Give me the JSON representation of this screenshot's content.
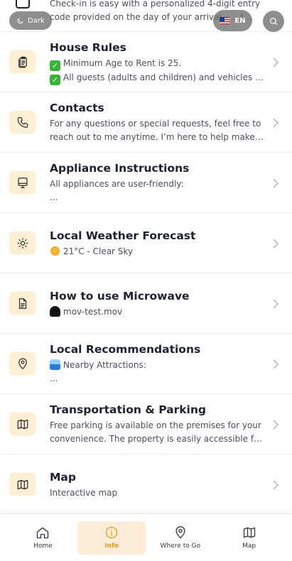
{
  "overlay": {
    "dark_label": "Dark",
    "lang_label": "EN"
  },
  "items": [
    {
      "title": "",
      "lines": [
        "Check-in is easy with a personalized 4-digit entry",
        "code provided on the day of your arrival... ...t..."
      ]
    },
    {
      "title": "House Rules",
      "lines": [
        "Minimum Age to Rent is 25.",
        "All guests (adults and children) and vehicles mu..."
      ]
    },
    {
      "title": "Contacts",
      "lines": [
        "For any questions or special requests, feel free to",
        "reach out to me anytime. I’m here to help make you..."
      ]
    },
    {
      "title": "Appliance Instructions",
      "lines": [
        "All appliances are user-friendly:",
        "..."
      ]
    },
    {
      "title": "Local Weather Forecast",
      "lines": [
        "21°C - Clear Sky"
      ]
    },
    {
      "title": "How to use Microwave",
      "lines": [
        "mov-test.mov"
      ]
    },
    {
      "title": "Local Recommendations",
      "lines": [
        "Nearby Attractions:",
        "..."
      ]
    },
    {
      "title": "Transportation & Parking",
      "lines": [
        "Free parking is available on the premises for your",
        "convenience. The property is easily accessible for..."
      ]
    },
    {
      "title": "Map",
      "lines": [
        "Interactive map"
      ]
    }
  ],
  "icons": {
    "house_rules": "clipboard-icon",
    "contacts": "phone-icon",
    "appliance": "monitor-icon",
    "weather": "sun-icon",
    "microwave": "document-icon",
    "recommendations": "location-pin-icon",
    "transport": "map-icon",
    "map": "map-icon"
  },
  "nav": [
    {
      "label": "Home"
    },
    {
      "label": "Info"
    },
    {
      "label": "Where to Go"
    },
    {
      "label": "Map"
    }
  ],
  "colors": {
    "accent": "#e39a1e",
    "icon_bg": "#fdefd3",
    "active_nav_bg": "#fdecd7"
  }
}
